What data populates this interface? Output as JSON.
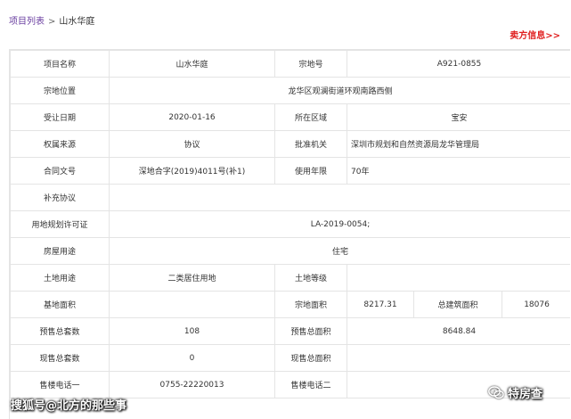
{
  "breadcrumb": {
    "parent": "项目列表",
    "separator": ">",
    "current": "山水华庭"
  },
  "seller_link": "卖方信息>>",
  "colors": {
    "link": "#6a3fa0",
    "seller": "#e02020",
    "border": "#e4e4e4"
  },
  "table": {
    "project_name_label": "项目名称",
    "project_name": "山水华庭",
    "parcel_no_label": "宗地号",
    "parcel_no": "A921-0855",
    "location_label": "宗地位置",
    "location": "龙华区观澜街道环观南路西侧",
    "transfer_date_label": "受让日期",
    "transfer_date": "2020-01-16",
    "district_label": "所在区域",
    "district": "宝安",
    "ownership_source_label": "权属来源",
    "ownership_source": "协议",
    "approval_org_label": "批准机关",
    "approval_org": "深圳市规划和自然资源局龙华管理局",
    "contract_no_label": "合同文号",
    "contract_no": "深地合字(2019)4011号(补1)",
    "usage_years_label": "使用年限",
    "usage_years": "70年",
    "supplement_label": "补充协议",
    "supplement": "",
    "planning_permit_label": "用地规划许可证",
    "planning_permit": "LA-2019-0054;",
    "housing_use_label": "房屋用途",
    "housing_use": "住宅",
    "land_use_label": "土地用途",
    "land_use": "二类居住用地",
    "land_grade_label": "土地等级",
    "land_grade": "",
    "base_area_label": "基地面积",
    "base_area": "",
    "parcel_area_label": "宗地面积",
    "parcel_area": "8217.31",
    "total_building_area_label": "总建筑面积",
    "total_building_area": "18076",
    "presale_units_label": "预售总套数",
    "presale_units": "108",
    "presale_area_label": "预售总面积",
    "presale_area": "8648.84",
    "current_units_label": "现售总套数",
    "current_units": "0",
    "current_area_label": "现售总面积",
    "current_area": "",
    "sales_phone1_label": "售楼电话一",
    "sales_phone1": "0755-22220013",
    "sales_phone2_label": "售楼电话二",
    "sales_phone2": ""
  },
  "watermarks": {
    "left": "搜狐号@北方的那些事",
    "right": "特房查",
    "right_icon": "wechat-icon"
  }
}
